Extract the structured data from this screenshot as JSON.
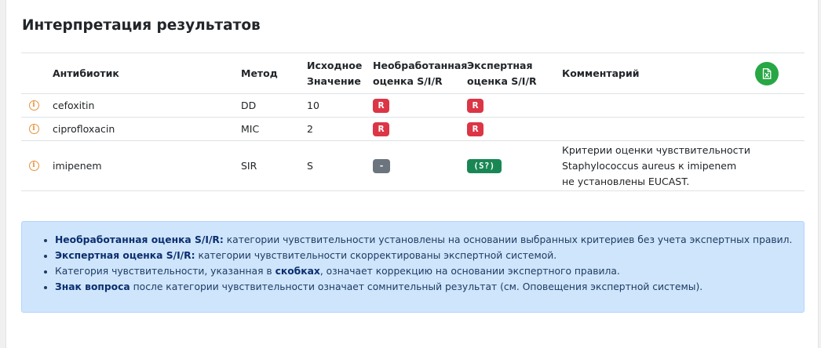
{
  "title": "Интерпретация результатов",
  "table": {
    "headers": {
      "antibiotic": "Антибиотик",
      "method": "Метод",
      "value_line1": "Исходное",
      "value_line2": "Значение",
      "raw_line1": "Необработанная",
      "raw_line2": "оценка S/I/R",
      "expert_line1": "Экспертная",
      "expert_line2": "оценка S/I/R",
      "comment": "Комментарий"
    },
    "rows": [
      {
        "antibiotic": "cefoxitin",
        "method": "DD",
        "value": "10",
        "raw": "R",
        "expert": "R",
        "comment": ""
      },
      {
        "antibiotic": "ciprofloxacin",
        "method": "MIC",
        "value": "2",
        "raw": "R",
        "expert": "R",
        "comment": ""
      },
      {
        "antibiotic": "imipenem",
        "method": "SIR",
        "value": "S",
        "raw": "-",
        "expert": "(S?)",
        "comment": "Критерии оценки чувствительности Staphylococcus aureus к imipenem не установлены EUCAST."
      }
    ]
  },
  "notes": [
    {
      "bold": "Необработанная оценка S/I/R:",
      "text": " категории чувствительности установлены на основании выбранных критериев без учета экспертных правил."
    },
    {
      "bold": "Экспертная оценка S/I/R:",
      "text": " категории чувствительности скорректированы экспертной системой."
    },
    {
      "pre": "Категория чувствительности, указанная в ",
      "bold": "скобках",
      "text": ", означает коррекцию на основании экспертного правила."
    },
    {
      "bold": "Знак вопроса",
      "text": " после категории чувствительности означает сомнительный результат (см. Оповещения экспертной системы)."
    }
  ],
  "icons": {
    "info": "info-circle-icon",
    "export": "excel-file-icon"
  },
  "colors": {
    "resistant": "#dc3545",
    "susceptible": "#198754",
    "unknown": "#6c757d",
    "export": "#28a745",
    "note_bg": "#cfe5fc"
  }
}
